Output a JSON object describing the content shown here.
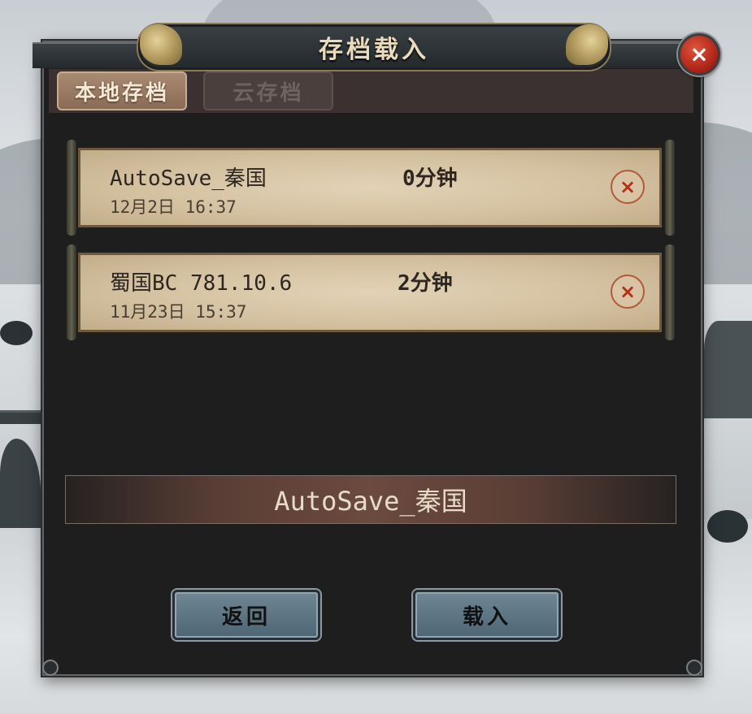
{
  "dialog": {
    "title": "存档载入",
    "close_icon": "×"
  },
  "tabs": [
    {
      "label": "本地存档",
      "active": true
    },
    {
      "label": "云存档",
      "active": false
    }
  ],
  "saves": [
    {
      "name": "AutoSave_秦国",
      "time": "12月2日 16:37",
      "duration": "0分钟",
      "delete_icon": "×"
    },
    {
      "name": "蜀国BC 781.10.6",
      "time": "11月23日 15:37",
      "duration": "2分钟",
      "delete_icon": "×"
    }
  ],
  "selected_save": "AutoSave_秦国",
  "buttons": {
    "back": "返回",
    "load": "载入"
  },
  "colors": {
    "accent_gold": "#e9dcbc",
    "close_red": "#b1271a",
    "paper": "#d3c09f",
    "button_blue": "#5f7785"
  }
}
